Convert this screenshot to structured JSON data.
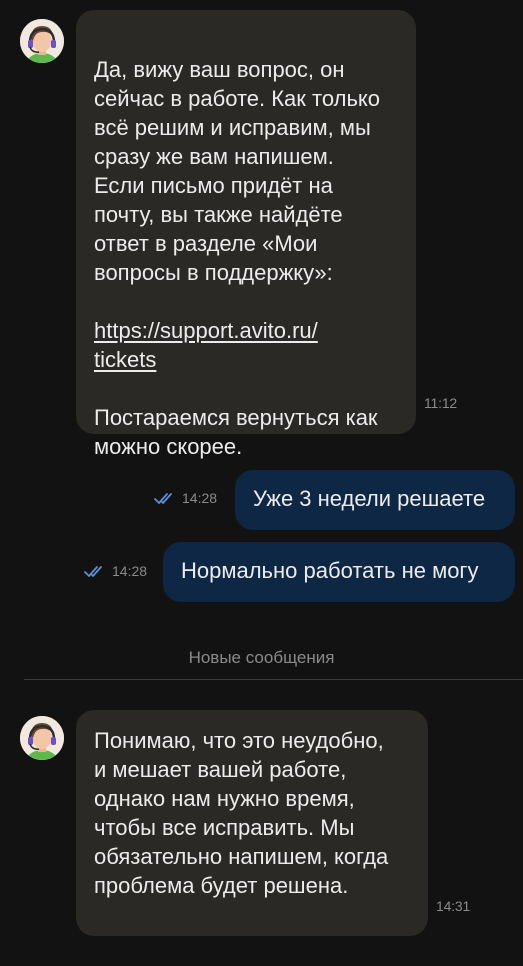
{
  "messages": [
    {
      "direction": "incoming",
      "text_before_link": "Да, вижу ваш вопрос, он\nсейчас в работе. Как только\nвсё решим и исправим, мы\nсразу же вам напишем.\nЕсли письмо придёт на\nпочту, вы также найдёте\nответ в разделе «Мои\nвопросы в поддержку»:",
      "link_line1": "https://support.avito.ru/",
      "link_line2": "tickets",
      "text_after_link": "Постараемся вернуться как\nможно скорее.",
      "time": "11:12"
    },
    {
      "direction": "outgoing",
      "text": "Уже 3 недели решаете",
      "time": "14:28",
      "status": "read"
    },
    {
      "direction": "outgoing",
      "text": "Нормально работать не могу",
      "time": "14:28",
      "status": "read"
    },
    {
      "direction": "incoming",
      "text": "Понимаю, что это неудобно,\nи мешает вашей работе,\nоднако нам нужно время,\nчтобы все исправить. Мы\nобязательно напишем, когда\nпроблема будет решена.",
      "time": "14:31"
    }
  ],
  "divider_label": "Новые сообщения",
  "colors": {
    "background": "#121212",
    "incoming_bubble": "#2b2926",
    "outgoing_bubble": "#0e2744",
    "read_ticks": "#5b8fd6",
    "meta_text": "#8b8b8b"
  },
  "icons": {
    "agent_avatar": "support-agent-avatar-icon",
    "read_status": "double-check-icon"
  }
}
